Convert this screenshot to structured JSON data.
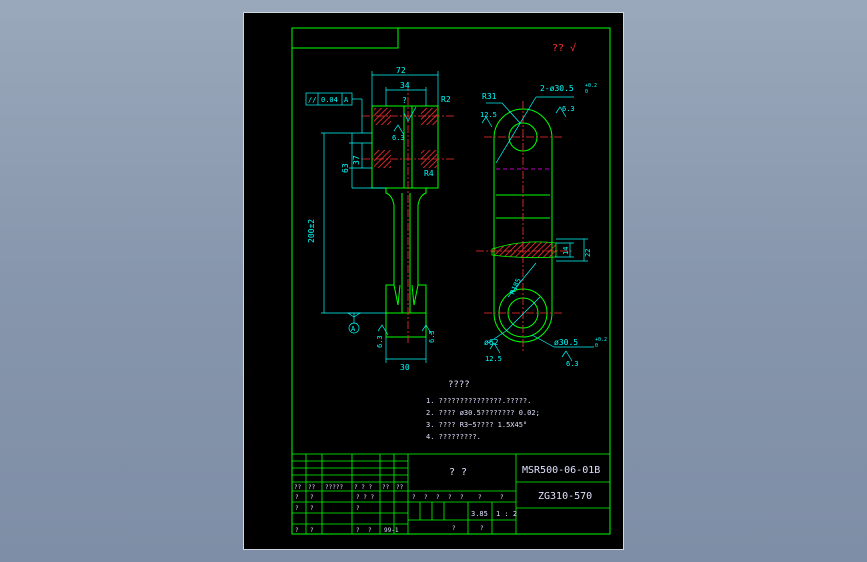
{
  "colors": {
    "background": "#8a99ae",
    "sheet": "#000000",
    "frame": "#00ff00",
    "dimension": "#00ffff",
    "centerline": "#ff3030",
    "hatch": "#ff3030",
    "hidden_line": "#ff00ff",
    "title_text": "#e0e0ff"
  },
  "drawing": {
    "roughness_mark": "?? √",
    "side_view": {
      "tolerance": {
        "symbol": "//",
        "value": "0.04",
        "datum": "A"
      },
      "overall_width": "72",
      "inner_width": "34",
      "angle": "?",
      "radius_top": "R2",
      "radius_mid": "R4",
      "height_small": "37",
      "height_mid": "63",
      "height_total": "200±2",
      "bottom_width": "30",
      "datum_label": "A",
      "roughness_left_top": "6.3",
      "roughness_left_bottom": "6.3",
      "roughness_right_bottom": "6.3"
    },
    "front_view": {
      "radius_top": "R31",
      "roughness_top_left": "12.5",
      "hole_callout": "2-ø30.5",
      "hole_tol_upper": "+0.2",
      "hole_tol_lower": "0",
      "roughness_top_right": "6.3",
      "section_dim_small": "14",
      "section_dim_large": "22",
      "arm_radius": "R185",
      "bottom_dia": "ø62",
      "roughness_bottom_left": "12.5",
      "bottom_hole": "ø30.5",
      "bottom_tol_upper": "+0.2",
      "bottom_tol_lower": "0",
      "roughness_bottom_right": "6.3"
    },
    "notes": {
      "heading": "????",
      "lines": [
        "1. ???????????????.?????.",
        "2. ????  ø30.5????????   0.02;",
        "3. ????  R3~5????     1.5X45°",
        "4. ?????????."
      ]
    },
    "title_block": {
      "part_name": "? ?",
      "drawing_number": "MSR500-06-01B",
      "material": "ZG310-570",
      "weight": "3.85",
      "scale": "1 : 2",
      "rev_header": [
        "??",
        "??",
        "?????",
        "? ? ?",
        "??",
        "??"
      ],
      "cells_row_a": [
        "?",
        "?",
        "? ? ?"
      ],
      "cells_row_b": [
        "?",
        "?",
        "?"
      ],
      "cells_row_c": [
        "?",
        "?",
        "?",
        "?",
        "99-1"
      ],
      "stage_labels": [
        "?",
        "?",
        "?",
        "?",
        "?",
        "?",
        "?"
      ],
      "mid_labels": [
        "?",
        "?"
      ]
    }
  }
}
